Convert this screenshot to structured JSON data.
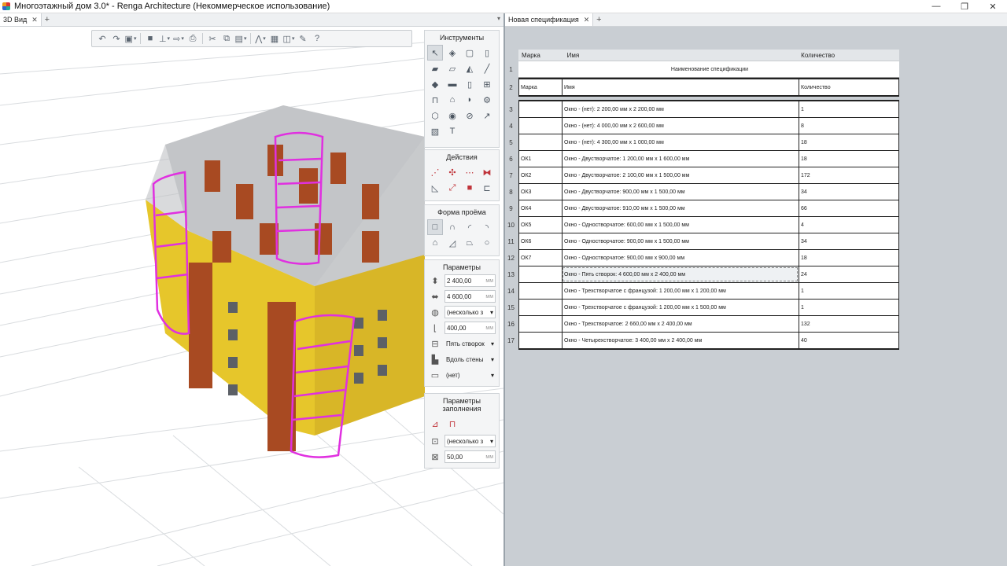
{
  "window": {
    "title": "Многоэтажный дом 3.0* - Renga Architecture (Некоммерческое использование)"
  },
  "tabs_left": [
    {
      "label": "3D Вид"
    }
  ],
  "tabs_right": [
    {
      "label": "Новая спецификация"
    }
  ],
  "panels": {
    "tools_title": "Инструменты",
    "actions_title": "Действия",
    "shape_title": "Форма проёма",
    "params_title": "Параметры",
    "fill_title": "Параметры заполнения"
  },
  "params": {
    "height": "2 400,00",
    "width": "4 600,00",
    "mix": "(несколько з",
    "offset": "400,00",
    "sashes": "Пять створок",
    "placement": "Вдоль стены",
    "style": "(нет)",
    "unit": "мм"
  },
  "fill": {
    "mix": "(несколько з",
    "value": "50,00",
    "unit": "мм"
  },
  "spec": {
    "col_headers": [
      "Марка",
      "Имя",
      "Количество"
    ],
    "table_title": "Наименование спецификации",
    "header_row": [
      "Марка",
      "Имя",
      "Количество"
    ],
    "rows": [
      {
        "n": "3",
        "mark": "",
        "name": "Окно - (нет): 2 200,00 мм x 2 200,00 мм",
        "qty": "1"
      },
      {
        "n": "4",
        "mark": "",
        "name": "Окно - (нет): 4 000,00 мм x 2 600,00 мм",
        "qty": "8"
      },
      {
        "n": "5",
        "mark": "",
        "name": "Окно - (нет): 4 300,00 мм x 1 000,00 мм",
        "qty": "18"
      },
      {
        "n": "6",
        "mark": "ОК1",
        "name": "Окно - Двустворчатое: 1 200,00 мм x 1 600,00 мм",
        "qty": "18"
      },
      {
        "n": "7",
        "mark": "ОК2",
        "name": "Окно - Двустворчатое: 2 100,00 мм x 1 500,00 мм",
        "qty": "172"
      },
      {
        "n": "8",
        "mark": "ОК3",
        "name": "Окно - Двустворчатое: 900,00 мм x 1 500,00 мм",
        "qty": "34"
      },
      {
        "n": "9",
        "mark": "ОК4",
        "name": "Окно - Двустворчатое: 910,00 мм x 1 500,00 мм",
        "qty": "66"
      },
      {
        "n": "10",
        "mark": "ОК5",
        "name": "Окно - Одностворчатое: 600,00 мм x 1 500,00 мм",
        "qty": "4"
      },
      {
        "n": "11",
        "mark": "ОК6",
        "name": "Окно - Одностворчатое: 900,00 мм x 1 500,00 мм",
        "qty": "34"
      },
      {
        "n": "12",
        "mark": "ОК7",
        "name": "Окно - Одностворчатое: 900,00 мм x 900,00 мм",
        "qty": "18"
      },
      {
        "n": "13",
        "mark": "",
        "name": "Окно - Пять створок: 4 600,00 мм x 2 400,00 мм",
        "qty": "24"
      },
      {
        "n": "14",
        "mark": "",
        "name": "Окно - Трехстворчатое с французой: 1 200,00 мм x 1 200,00 мм",
        "qty": "1"
      },
      {
        "n": "15",
        "mark": "",
        "name": "Окно - Трехстворчатое с французой: 1 200,00 мм x 1 500,00 мм",
        "qty": "1"
      },
      {
        "n": "16",
        "mark": "",
        "name": "Окно - Трехстворчатое: 2 660,00 мм x 2 400,00 мм",
        "qty": "132"
      },
      {
        "n": "17",
        "mark": "",
        "name": "Окно - Четырехстворчатое: 3 400,00 мм x 2 400,00 мм",
        "qty": "40"
      }
    ]
  }
}
